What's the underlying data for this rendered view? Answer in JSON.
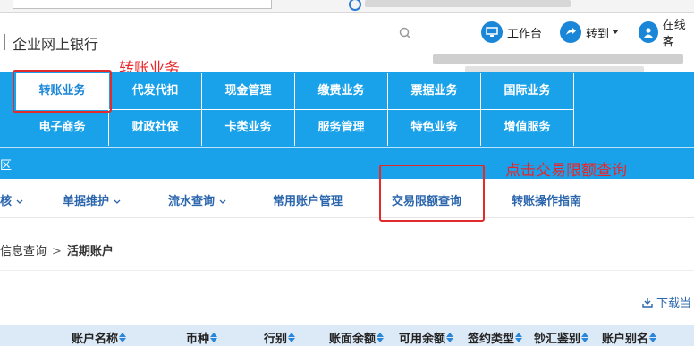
{
  "header": {
    "brand": "企业网上银行",
    "workbench": "工作台",
    "goto": "转到",
    "online_service": "在线客"
  },
  "annotations": {
    "transfer": "转账业务",
    "click_query": "点击交易限额查询"
  },
  "nav": {
    "row1": [
      "转账业务",
      "代发代扣",
      "现金管理",
      "缴费业务",
      "票据业务",
      "国际业务"
    ],
    "row2": [
      "电子商务",
      "财政社保",
      "卡类业务",
      "服务管理",
      "特色业务",
      "增值服务"
    ],
    "zone": "区",
    "active_index": 0
  },
  "subnav": {
    "items": [
      {
        "label": "核",
        "has_dropdown": true
      },
      {
        "label": "单据维护",
        "has_dropdown": true
      },
      {
        "label": "流水查询",
        "has_dropdown": true
      },
      {
        "label": "常用账户管理",
        "has_dropdown": false
      },
      {
        "label": "交易限额查询",
        "has_dropdown": false
      },
      {
        "label": "转账操作指南",
        "has_dropdown": false
      }
    ]
  },
  "breadcrumb": {
    "parent": "信息查询",
    "current": "活期账户"
  },
  "download": {
    "label": "下载当"
  },
  "table": {
    "columns": [
      "账户名称",
      "币种",
      "行别",
      "账面余额",
      "可用余额",
      "签约类型",
      "钞汇鉴别",
      "账户别名"
    ]
  },
  "colors": {
    "nav_bg": "#19a2ea",
    "accent": "#1a86d8",
    "annotation_red": "#e8262a",
    "link_blue": "#2b66ad"
  },
  "icons": [
    "search-icon",
    "monitor-icon",
    "forward-arrow-icon",
    "user-icon",
    "download-icon",
    "sort-icon"
  ]
}
